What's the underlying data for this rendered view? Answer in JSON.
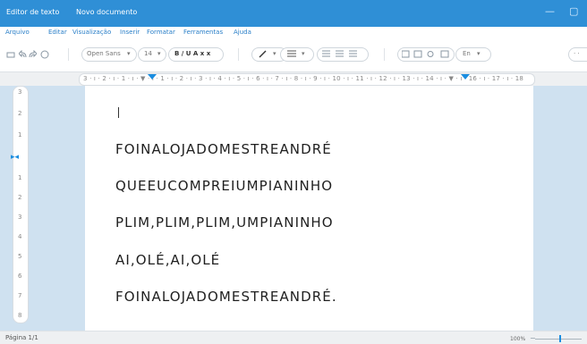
{
  "window": {
    "app_title": "Editor de texto",
    "doc_title": "Novo documento",
    "minimize_glyph": "—",
    "maximize_glyph": "▢"
  },
  "menu": {
    "items": [
      "Arquivo",
      "Editar",
      "Visualização",
      "Inserir",
      "Formatar",
      "Ferramentas",
      "Ajuda"
    ]
  },
  "toolbar": {
    "font_family": "Open Sans",
    "font_size": "14",
    "format_buttons": "B / U A x x",
    "language": "En",
    "dropdown_arrow": "▾",
    "more": "· ·"
  },
  "ruler": {
    "text": "3 · ı · 2 · ı · 1 · ı · ▼ · ı · 1 · ı · 2 · ı · 3 · ı · 4 · ı · 5 · ı · 6 · ı · 7 · ı · 8 · ı · 9 · ı · 10 · ı · 11 · ı · 12 · ı · 13 · ı · 14 · ı · ▼ · ı · 16 · ı · 17 · ı · 18"
  },
  "vruler": {
    "numbers": [
      "3",
      "2",
      "1",
      "1",
      "2",
      "3",
      "4",
      "5",
      "6",
      "7",
      "8"
    ],
    "marker": "▸◂"
  },
  "document": {
    "lines": [
      "FOINALOJADOMESTREANDRÉ",
      "QUEEUCOMPREIUMPIANINHO",
      "PLIM,PLIM,PLIM,UMPIANINHO",
      "AI,OLÉ,AI,OLÉ",
      "FOINALOJADOMESTREANDRÉ."
    ]
  },
  "status": {
    "page": "Página 1/1",
    "zoom": "100%",
    "zoom_minus": "−"
  },
  "colors": {
    "titlebar": "#2f8fd6",
    "menu_text": "#2a7fc8",
    "workspace": "#cfe1f0",
    "accent": "#1a8de0"
  }
}
